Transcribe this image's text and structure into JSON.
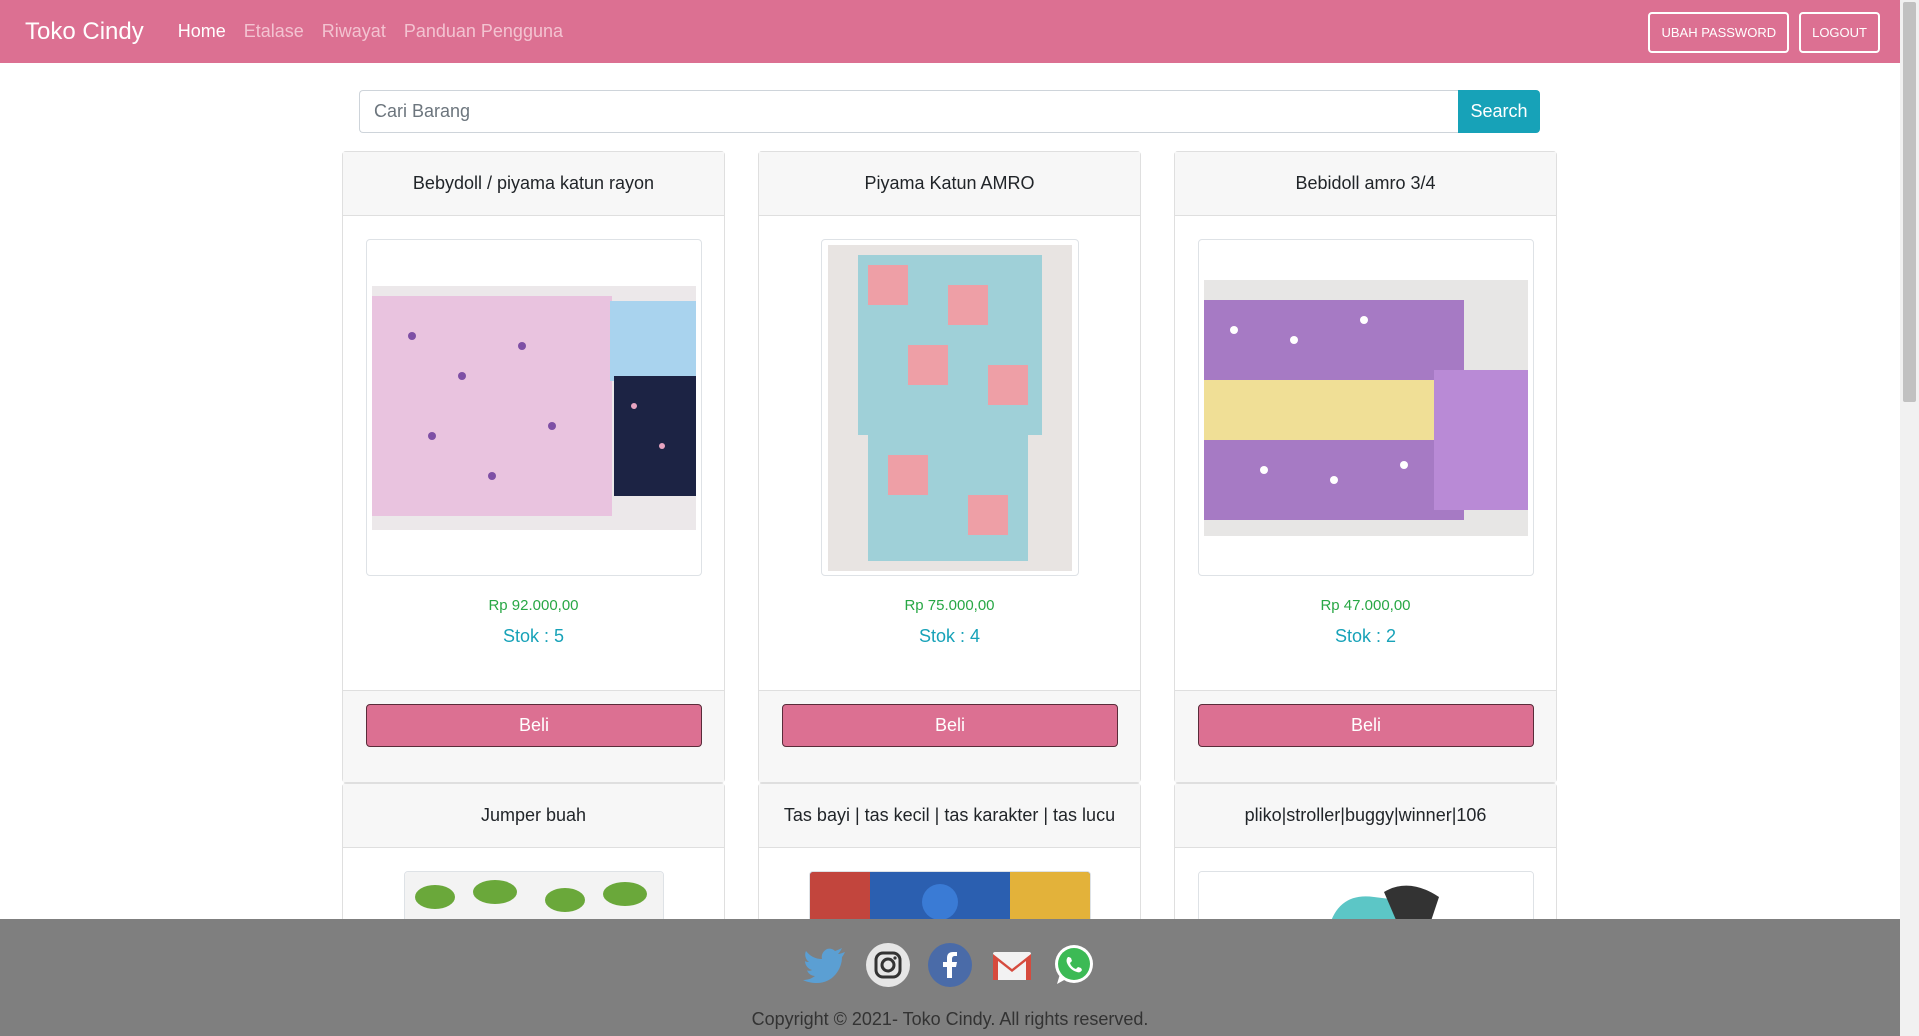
{
  "navbar": {
    "brand": "Toko Cindy",
    "links": [
      "Home",
      "Etalase",
      "Riwayat",
      "Panduan Pengguna"
    ],
    "buttons": [
      "UBAH PASSWORD",
      "LOGOUT"
    ]
  },
  "search": {
    "placeholder": "Cari Barang",
    "button": "Search"
  },
  "products": [
    {
      "name": "Bebydoll / piyama katun rayon",
      "price": "Rp 92.000,00",
      "stock": "Stok : 5",
      "buy": "Beli"
    },
    {
      "name": "Piyama Katun AMRO",
      "price": "Rp 75.000,00",
      "stock": "Stok : 4",
      "buy": "Beli"
    },
    {
      "name": "Bebidoll amro 3/4",
      "price": "Rp 47.000,00",
      "stock": "Stok : 2",
      "buy": "Beli"
    },
    {
      "name": "Jumper buah"
    },
    {
      "name": "Tas bayi | tas kecil | tas karakter | tas lucu"
    },
    {
      "name": "pliko|stroller|buggy|winner|106"
    }
  ],
  "footer": {
    "social_icons": [
      "twitter-icon",
      "instagram-icon",
      "facebook-icon",
      "gmail-icon",
      "whatsapp-icon"
    ],
    "copyright": "Copyright © 2021- Toko Cindy. All rights reserved."
  },
  "colors": {
    "primary": "#dc7092",
    "info": "#17a2b8",
    "success": "#28a745",
    "footer": "#7f7f7f"
  }
}
